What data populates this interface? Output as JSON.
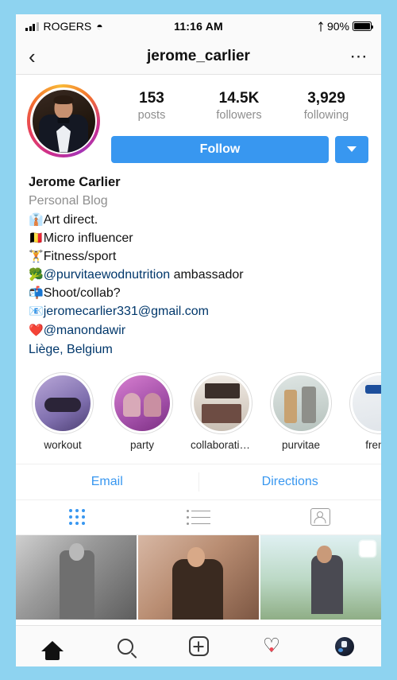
{
  "status_bar": {
    "signal_icon": "signal-bars-icon",
    "carrier": "ROGERS",
    "wifi_icon": "wifi-icon",
    "time": "11:16 AM",
    "bluetooth_icon": "bluetooth-icon",
    "battery_percent": "90%",
    "battery_icon": "battery-full-icon"
  },
  "nav": {
    "back_icon": "chevron-left-icon",
    "title": "jerome_carlier",
    "more_icon": "ellipsis-icon"
  },
  "profile": {
    "avatar_name": "profile-avatar",
    "has_story_ring": true,
    "stats": [
      {
        "value": "153",
        "label": "posts"
      },
      {
        "value": "14.5K",
        "label": "followers"
      },
      {
        "value": "3,929",
        "label": "following"
      }
    ],
    "follow_label": "Follow",
    "dropdown_icon": "chevron-down-icon",
    "accent_color": "#3897f0"
  },
  "bio": {
    "name": "Jerome Carlier",
    "category": "Personal Blog",
    "lines": [
      {
        "emoji": "👔",
        "text": "Art direct.",
        "link": ""
      },
      {
        "emoji": "🇧🇪",
        "text": "Micro influencer",
        "link": ""
      },
      {
        "emoji": "🏋️",
        "text": "Fitness/sport",
        "link": ""
      },
      {
        "emoji": "🥦",
        "text": " ambassador",
        "link": "@purvitaewodnutrition"
      },
      {
        "emoji": "📬",
        "text": "Shoot/collab?",
        "link": ""
      },
      {
        "emoji": "📧",
        "text": "",
        "link": "jeromecarlier331@gmail.com"
      },
      {
        "emoji": "❤️",
        "text": "",
        "link": "@manondawir"
      }
    ],
    "location": "Liège, Belgium"
  },
  "highlights": [
    {
      "label": "workout"
    },
    {
      "label": "party"
    },
    {
      "label": "collaboratio..."
    },
    {
      "label": "purvitae"
    },
    {
      "label": "french"
    }
  ],
  "contact": {
    "email_label": "Email",
    "directions_label": "Directions"
  },
  "tabs": [
    {
      "name": "grid-tab",
      "icon": "grid-icon",
      "active": true
    },
    {
      "name": "list-tab",
      "icon": "list-icon",
      "active": false
    },
    {
      "name": "tagged-tab",
      "icon": "tagged-person-icon",
      "active": false
    }
  ],
  "posts": [
    {
      "name": "post-1",
      "multi": false
    },
    {
      "name": "post-2",
      "multi": false
    },
    {
      "name": "post-3",
      "multi": true
    }
  ],
  "tabbar": [
    {
      "name": "home-tab",
      "icon": "home-icon",
      "active": true,
      "badge": false
    },
    {
      "name": "search-tab",
      "icon": "search-icon",
      "active": false,
      "badge": false
    },
    {
      "name": "add-post-tab",
      "icon": "plus-square-icon",
      "active": false,
      "badge": false
    },
    {
      "name": "activity-tab",
      "icon": "heart-icon",
      "active": false,
      "badge": true
    },
    {
      "name": "profile-tab",
      "icon": "profile-avatar-icon",
      "active": false,
      "badge": false
    }
  ]
}
